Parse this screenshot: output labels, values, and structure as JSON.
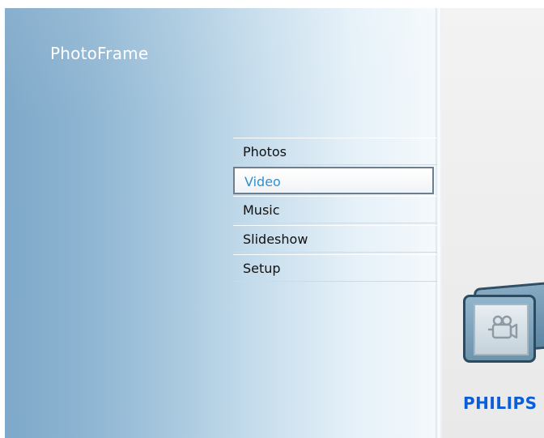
{
  "app": {
    "title": "PhotoFrame"
  },
  "menu": {
    "items": [
      {
        "label": "Photos"
      },
      {
        "label": "Video",
        "selected": true
      },
      {
        "label": "Music"
      },
      {
        "label": "Slideshow"
      },
      {
        "label": "Setup"
      }
    ]
  },
  "sidebar": {
    "selected_icon": "video-camera-icon"
  },
  "brand": {
    "logo": "PHILIPS"
  },
  "colors": {
    "accent": "#2f8fd0",
    "brand": "#0b5ed7",
    "background_blue": "#7ea8c9"
  }
}
